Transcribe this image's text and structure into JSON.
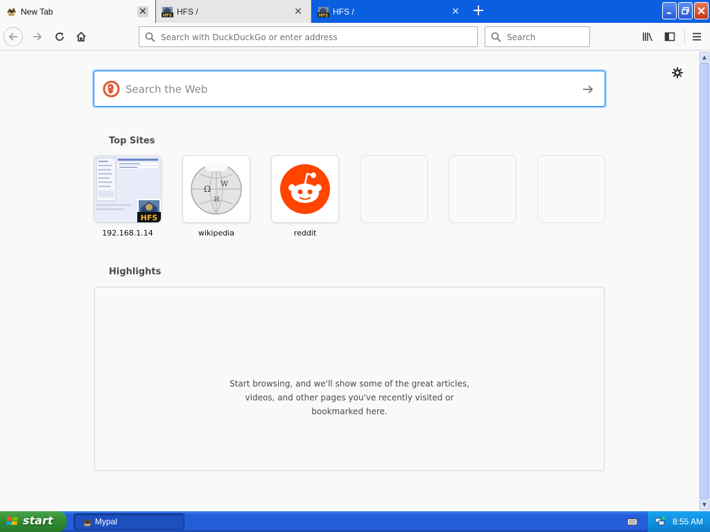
{
  "browser": {
    "tabs": [
      {
        "title": "New Tab",
        "icon": "hfs-browser-icon",
        "active": true
      },
      {
        "title": "HFS /",
        "icon": "hfs-icon",
        "active": false
      },
      {
        "title": "HFS /",
        "icon": "hfs-icon",
        "active": false
      }
    ],
    "new_tab_label": "+",
    "url_placeholder": "Search with DuckDuckGo or enter address",
    "search_placeholder": "Search",
    "accent_color": "#0a84ff",
    "titlebar_color": "#0a5fe0"
  },
  "newtab": {
    "web_search_placeholder": "Search the Web",
    "top_sites_title": "Top Sites",
    "top_sites": [
      {
        "label": "192.168.1.14",
        "icon": "hfs-screenshot"
      },
      {
        "label": "wikipedia",
        "icon": "wikipedia-globe"
      },
      {
        "label": "reddit",
        "icon": "reddit-alien"
      },
      {
        "label": "",
        "icon": "empty"
      },
      {
        "label": "",
        "icon": "empty"
      },
      {
        "label": "",
        "icon": "empty"
      }
    ],
    "highlights_title": "Highlights",
    "highlights_message_lines": [
      "Start browsing, and we'll show some of the great articles,",
      "videos, and other pages you've recently visited or",
      "bookmarked here."
    ],
    "reddit_color": "#ff4500"
  },
  "taskbar": {
    "start_label": "start",
    "tasks": [
      {
        "title": "Mypal"
      }
    ],
    "clock": "8:55 AM"
  }
}
